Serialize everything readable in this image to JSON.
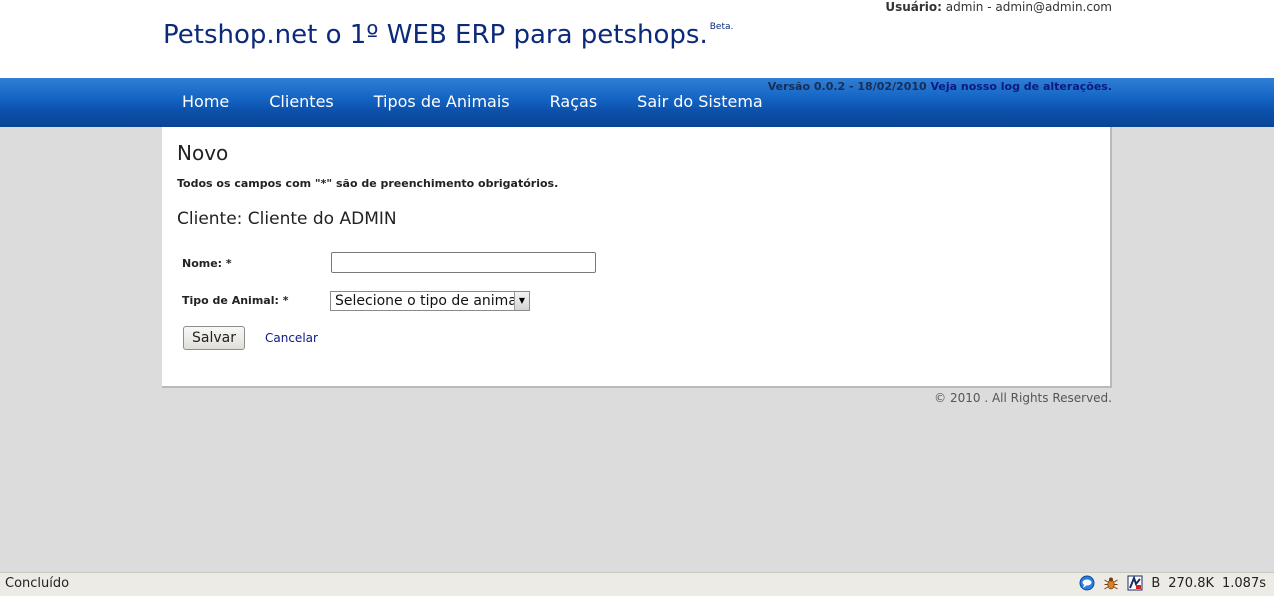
{
  "header": {
    "user_label": "Usuário:",
    "user_value": "admin - admin@admin.com",
    "title": "Petshop.net o 1º WEB ERP para petshops.",
    "title_badge": "Beta."
  },
  "nav": {
    "items": [
      {
        "label": "Home"
      },
      {
        "label": "Clientes"
      },
      {
        "label": "Tipos de Animais"
      },
      {
        "label": "Raças"
      },
      {
        "label": "Sair do Sistema"
      }
    ],
    "version_text": "Versão 0.0.2 - 18/02/2010",
    "changelog_link": "Veja nosso log de alterações."
  },
  "form": {
    "title": "Novo",
    "required_note": "Todos os campos com \"*\" são de preenchimento obrigatórios.",
    "client_line": "Cliente: Cliente do ADMIN",
    "nome_label": "Nome: *",
    "nome_value": "",
    "tipo_label": "Tipo de Animal: *",
    "tipo_selected": "Selecione o tipo de animal.",
    "save_label": "Salvar",
    "cancel_label": "Cancelar"
  },
  "footer": {
    "copyright": "© 2010 . All Rights Reserved."
  },
  "statusbar": {
    "status_text": "Concluído",
    "b_label": "B",
    "size": "270.8K",
    "time": "1.087s",
    "icons": [
      "chat-bubble-icon",
      "firebug-bug-icon",
      "yslow-icon"
    ]
  },
  "colors": {
    "nav_gradient_top": "#2f7fd6",
    "nav_gradient_bottom": "#0a4596",
    "title_color": "#0c2a7a",
    "link_color": "#0c1a80",
    "background": "#dcdcdc"
  }
}
